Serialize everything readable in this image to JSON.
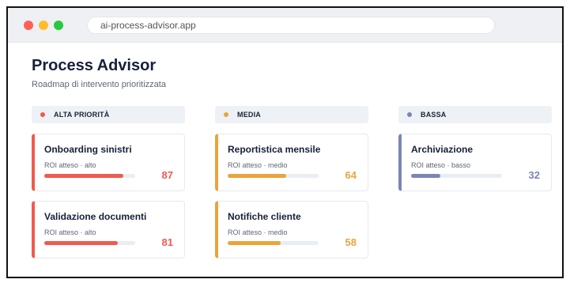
{
  "browser": {
    "url": "ai-process-advisor.app"
  },
  "header": {
    "title": "Process Advisor",
    "subtitle": "Roadmap di intervento prioritizzata"
  },
  "columns": [
    {
      "label": "ALTA PRIORITÀ",
      "color": "#f05a4f",
      "cards": [
        {
          "title": "Onboarding sinistri",
          "meta": "ROI atteso · alto",
          "score": "87",
          "progress": 0.87
        },
        {
          "title": "Validazione documenti",
          "meta": "ROI atteso · alto",
          "score": "81",
          "progress": 0.81
        }
      ]
    },
    {
      "label": "MEDIA",
      "color": "#eaa43a",
      "cards": [
        {
          "title": "Reportistica mensile",
          "meta": "ROI atteso · medio",
          "score": "64",
          "progress": 0.64
        },
        {
          "title": "Notifiche cliente",
          "meta": "ROI atteso · medio",
          "score": "58",
          "progress": 0.58
        }
      ]
    },
    {
      "label": "BASSA",
      "color": "#7a86b4",
      "cards": [
        {
          "title": "Archiviazione",
          "meta": "ROI atteso · basso",
          "score": "32",
          "progress": 0.32
        }
      ]
    }
  ]
}
